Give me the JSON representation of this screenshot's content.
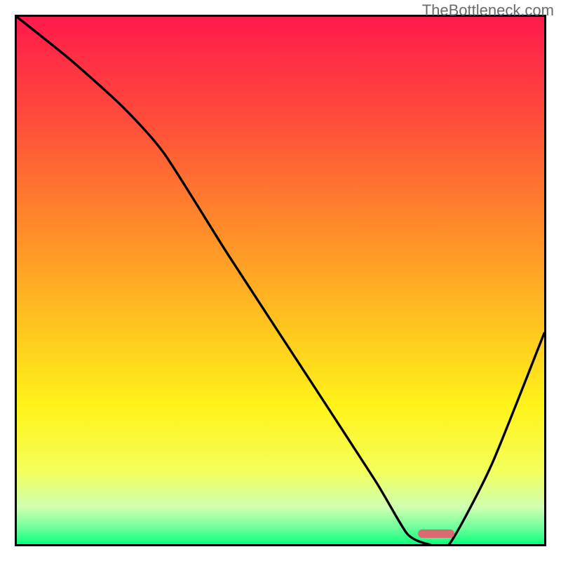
{
  "watermark": "TheBottleneck.com",
  "chart_data": {
    "type": "line",
    "title": "",
    "xlabel": "",
    "ylabel": "",
    "xlim": [
      0,
      100
    ],
    "ylim": [
      0,
      100
    ],
    "grid": false,
    "legend": false,
    "background_gradient_stops": [
      {
        "offset": 0.0,
        "color": "#ff1a4b"
      },
      {
        "offset": 0.2,
        "color": "#ff4e3a"
      },
      {
        "offset": 0.4,
        "color": "#ff8b2a"
      },
      {
        "offset": 0.58,
        "color": "#ffc31f"
      },
      {
        "offset": 0.74,
        "color": "#fff31a"
      },
      {
        "offset": 0.86,
        "color": "#f4ff5a"
      },
      {
        "offset": 0.93,
        "color": "#cfffb0"
      },
      {
        "offset": 0.97,
        "color": "#6bff9a"
      },
      {
        "offset": 1.0,
        "color": "#0aff7a"
      }
    ],
    "series": [
      {
        "name": "bottleneck-curve",
        "x": [
          0,
          10,
          20,
          28,
          40,
          55,
          68,
          74,
          78,
          82,
          90,
          100
        ],
        "y": [
          100,
          92,
          83,
          74,
          55,
          32,
          12,
          2,
          0,
          0,
          15,
          40
        ]
      }
    ],
    "marker": {
      "name": "optimal-range",
      "x_start": 76,
      "x_end": 83,
      "y": 1.2,
      "color": "#d96a6f"
    }
  }
}
